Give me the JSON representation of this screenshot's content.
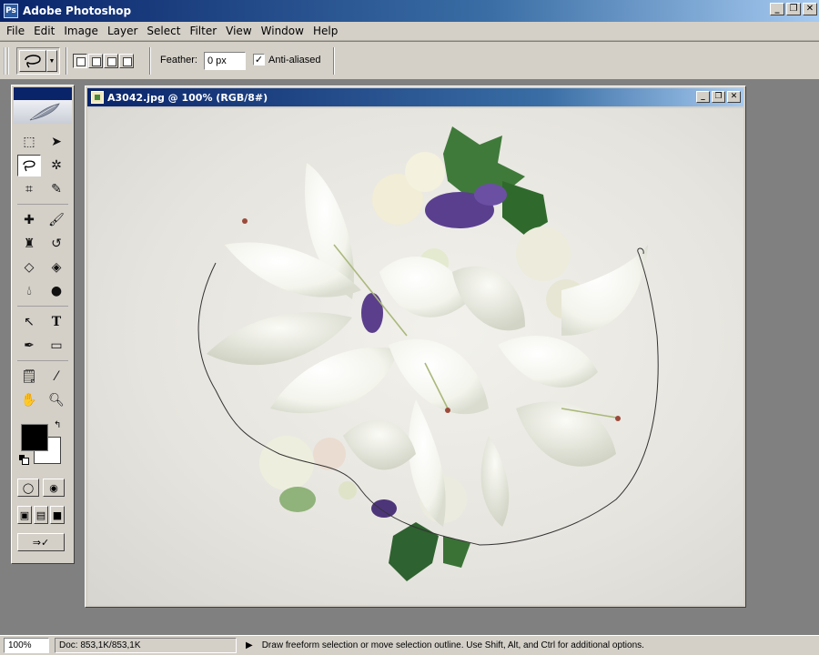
{
  "app": {
    "title": "Adobe Photoshop",
    "icon": "photoshop-icon"
  },
  "window_controls": {
    "minimize": "_",
    "restore": "❐",
    "close": "✕"
  },
  "menu": [
    "File",
    "Edit",
    "Image",
    "Layer",
    "Select",
    "Filter",
    "View",
    "Window",
    "Help"
  ],
  "options": {
    "feather_label": "Feather:",
    "feather_value": "0 px",
    "antialiased_label": "Anti-aliased",
    "antialiased_checked": true,
    "active_tool_icon": "lasso-icon",
    "selection_modes": [
      "new-selection",
      "add-to-selection",
      "subtract-from-selection",
      "intersect-selection"
    ]
  },
  "toolbox": {
    "tools": [
      [
        "marquee",
        "move"
      ],
      [
        "lasso",
        "magic-wand"
      ],
      [
        "crop",
        "slice"
      ],
      [
        "healing-brush",
        "brush"
      ],
      [
        "clone-stamp",
        "history-brush"
      ],
      [
        "eraser",
        "paint-bucket"
      ],
      [
        "blur",
        "dodge"
      ],
      [
        "path-selection",
        "type"
      ],
      [
        "pen",
        "rectangle"
      ],
      [
        "notes",
        "eyedropper"
      ],
      [
        "hand",
        "zoom"
      ]
    ],
    "active_tool": "lasso",
    "foreground_color": "#000000",
    "background_color": "#ffffff"
  },
  "document": {
    "title": "A3042.jpg @ 100% (RGB/8#)"
  },
  "status": {
    "zoom": "100%",
    "doc_info": "Doc: 853,1K/853,1K",
    "message": "Draw freeform selection or move selection outline.  Use Shift, Alt, and Ctrl for additional options."
  },
  "colors": {
    "title_blue": "#0a246a",
    "face": "#d4d0c8",
    "workspace": "#808080"
  }
}
